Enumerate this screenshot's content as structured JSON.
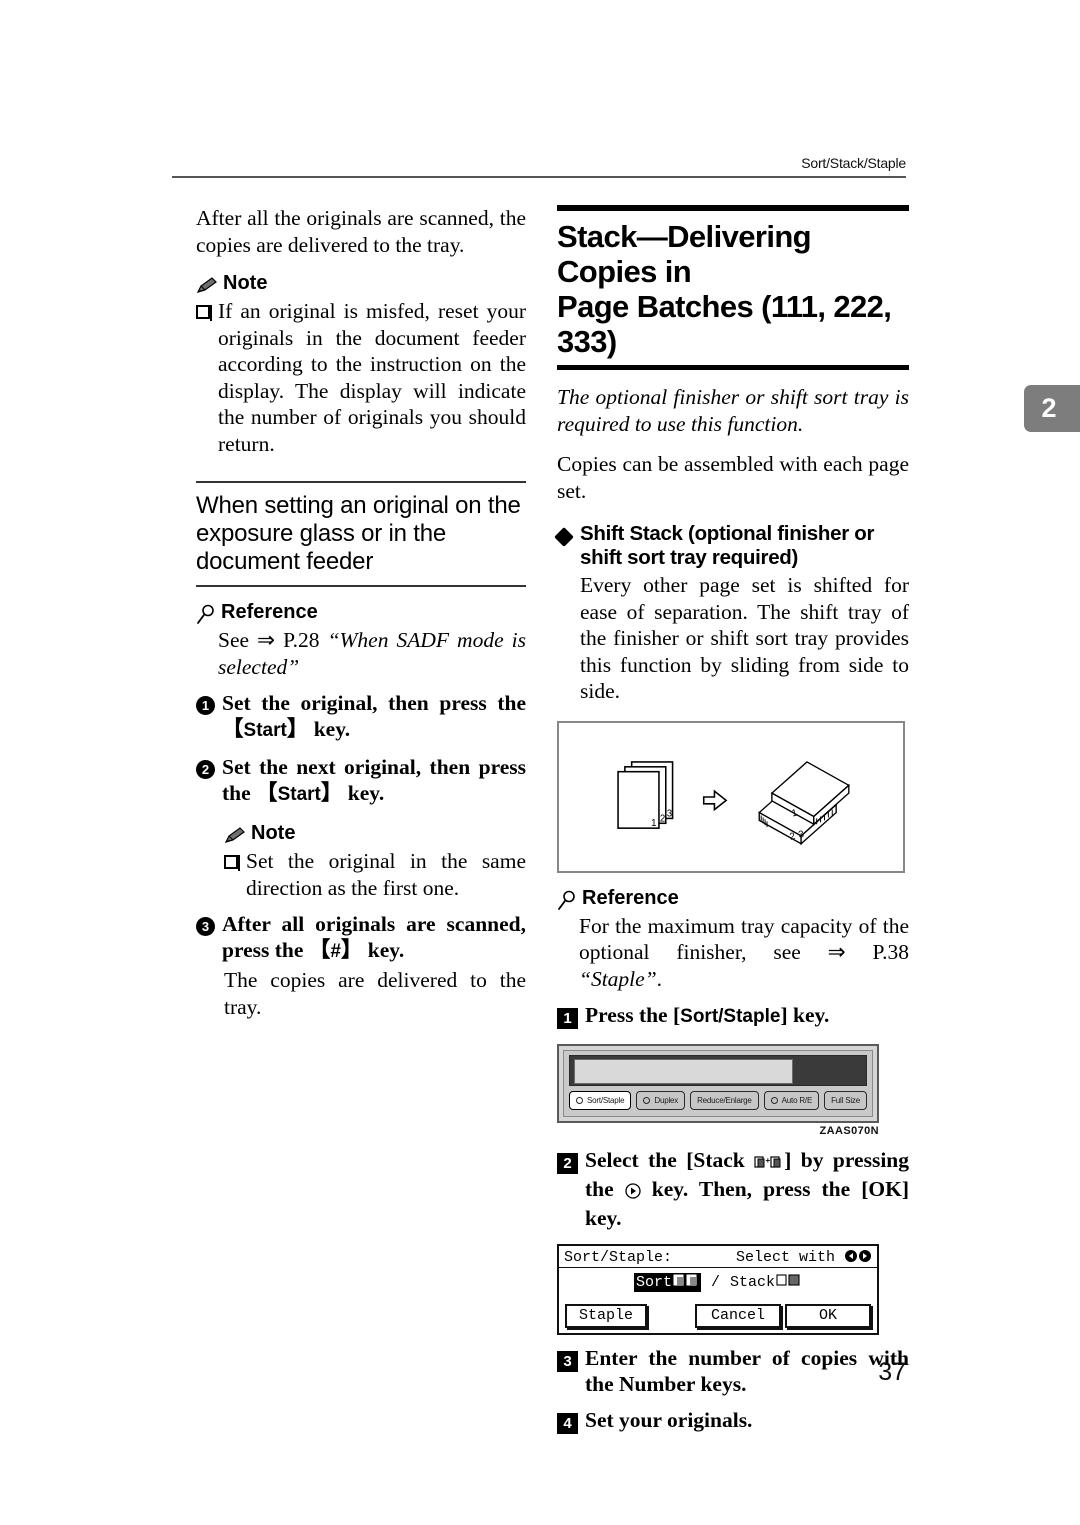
{
  "page": {
    "running_head": "Sort/Stack/Staple",
    "chapter_tab": "2",
    "page_number": "37"
  },
  "left_column": {
    "intro_paragraph": "After all the originals are scanned, the copies are delivered to the tray.",
    "note_label": "Note",
    "note_items": [
      "If an original is misfed, reset your originals in the document feeder according to the instruction on the display. The display will indicate the number of originals you should return."
    ],
    "section_heading": "When setting an original on the exposure glass or in the document feeder",
    "reference_label": "Reference",
    "reference_text_prefix": "See ⇒ P.28 ",
    "reference_text_italic": "“When SADF mode is selected”",
    "steps": [
      {
        "num": "1",
        "text_before": "Set the original, then press the ",
        "key": "Start",
        "text_after": " key."
      },
      {
        "num": "2",
        "text_before": "Set the next original, then press the ",
        "key": "Start",
        "text_after": " key."
      },
      {
        "num": "3",
        "text_before": "After all originals are scanned, press the ",
        "key": "#",
        "text_after": " key."
      }
    ],
    "step2_note_label": "Note",
    "step2_note_items": [
      "Set the original in the same direction as the first one."
    ],
    "step3_result": "The copies are delivered to the tray."
  },
  "right_column": {
    "title_line1": "Stack—Delivering Copies in",
    "title_line2": "Page Batches (111, 222, 333)",
    "requirement_italic": "The optional finisher or shift sort tray is required to use this function.",
    "lead_paragraph": "Copies can be assembled with each page set.",
    "subsection": {
      "heading": "Shift Stack (optional finisher or shift sort tray required)",
      "body": "Every other page set is shifted for ease of separation. The shift tray of the finisher or shift sort tray provides this function by sliding from side to side."
    },
    "illustration": {
      "caption": "originals-to-shifted-stack-diagram",
      "left_page_numbers": [
        "1",
        "2",
        "3"
      ],
      "right_stack_numbers": [
        "1",
        "2",
        "3"
      ],
      "arrow": "⇨"
    },
    "reference_label": "Reference",
    "reference_text": "For the maximum tray capacity of the optional finisher, see ⇒ P.38 ",
    "reference_text_italic": "“Staple”",
    "reference_text_tail": ".",
    "steps": [
      {
        "num": "1",
        "text_before": "Press the [",
        "key": "Sort/Staple",
        "text_after": "] key."
      },
      {
        "num": "2",
        "text_before": "Select the [Stack ",
        "icon": "stack-glyph",
        "text_mid": "] by pressing the ",
        "key2": "right-arrow-key",
        "text_after": " key. Then, press the [OK] key."
      },
      {
        "num": "3",
        "text": "Enter the number of copies with the Number keys."
      },
      {
        "num": "4",
        "text": "Set your originals."
      }
    ],
    "control_panel": {
      "figure_id": "ZAAS070N",
      "buttons": [
        {
          "label": "Sort/Staple",
          "has_led": true,
          "active": true
        },
        {
          "label": "Duplex",
          "has_led": true,
          "active": false
        },
        {
          "label": "Reduce/Enlarge",
          "has_led": false,
          "active": false
        },
        {
          "label": "Auto R/E",
          "has_led": true,
          "active": false
        },
        {
          "label": "Full Size",
          "has_led": false,
          "active": false
        }
      ]
    },
    "lcd": {
      "title": "Sort/Staple:",
      "hint": "Select with",
      "hint_icons": [
        "left-arrow-icon",
        "right-arrow-icon"
      ],
      "option_selected": "Sort",
      "separator": "/",
      "option_other": "Stack",
      "buttons": [
        {
          "label": "Staple"
        },
        {
          "label": "Cancel"
        },
        {
          "label": "OK"
        }
      ]
    }
  }
}
